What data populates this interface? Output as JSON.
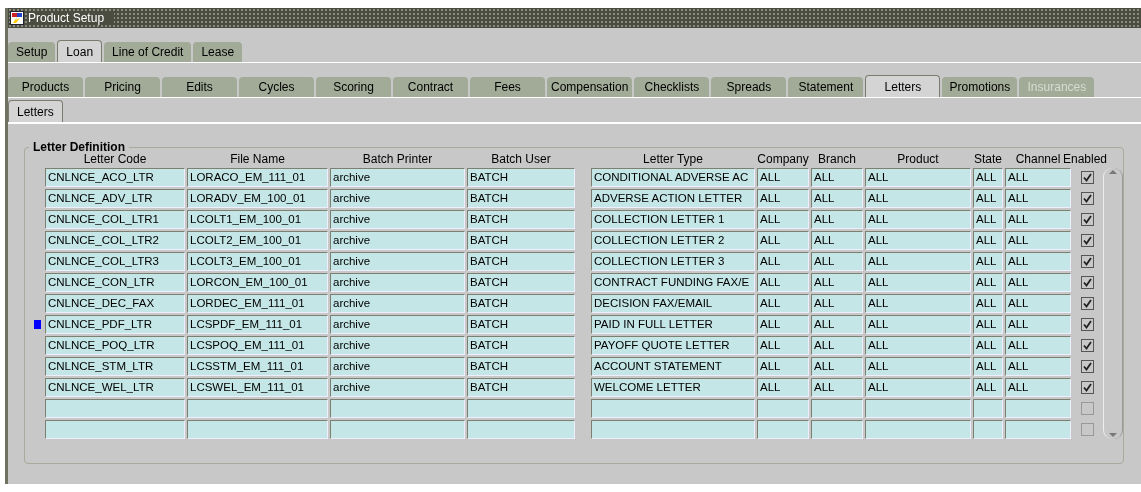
{
  "window": {
    "title": "Product Setup"
  },
  "tabs": [
    {
      "label": "Setup",
      "selected": false
    },
    {
      "label": "Loan",
      "selected": true
    },
    {
      "label": "Line of Credit",
      "selected": false
    },
    {
      "label": "Lease",
      "selected": false
    }
  ],
  "subtabs": [
    {
      "label": "Products",
      "selected": false,
      "disabled": false
    },
    {
      "label": "Pricing",
      "selected": false,
      "disabled": false
    },
    {
      "label": "Edits",
      "selected": false,
      "disabled": false
    },
    {
      "label": "Cycles",
      "selected": false,
      "disabled": false
    },
    {
      "label": "Scoring",
      "selected": false,
      "disabled": false
    },
    {
      "label": "Contract",
      "selected": false,
      "disabled": false
    },
    {
      "label": "Fees",
      "selected": false,
      "disabled": false
    },
    {
      "label": "Compensation",
      "selected": false,
      "disabled": false
    },
    {
      "label": "Checklists",
      "selected": false,
      "disabled": false
    },
    {
      "label": "Spreads",
      "selected": false,
      "disabled": false
    },
    {
      "label": "Statement",
      "selected": false,
      "disabled": false
    },
    {
      "label": "Letters",
      "selected": true,
      "disabled": false
    },
    {
      "label": "Promotions",
      "selected": false,
      "disabled": false
    },
    {
      "label": "Insurances",
      "selected": false,
      "disabled": true
    }
  ],
  "inner_tabs": [
    {
      "label": "Letters",
      "selected": true
    }
  ],
  "group": {
    "title": "Letter Definition",
    "columns": [
      "Letter Code",
      "File Name",
      "Batch Printer",
      "Batch User",
      "Letter Type",
      "Company",
      "Branch",
      "Product",
      "State",
      "Channel",
      "Enabled"
    ],
    "rows": [
      {
        "selected": false,
        "letter_code": "CNLNCE_ACO_LTR",
        "file_name": "LORACO_EM_111_01",
        "batch_printer": "archive",
        "batch_user": "BATCH",
        "letter_type": "CONDITIONAL ADVERSE AC",
        "company": "ALL",
        "branch": "ALL",
        "product": "ALL",
        "state": "ALL",
        "channel": "ALL",
        "enabled": true
      },
      {
        "selected": false,
        "letter_code": "CNLNCE_ADV_LTR",
        "file_name": "LORADV_EM_100_01",
        "batch_printer": "archive",
        "batch_user": "BATCH",
        "letter_type": "ADVERSE ACTION LETTER",
        "company": "ALL",
        "branch": "ALL",
        "product": "ALL",
        "state": "ALL",
        "channel": "ALL",
        "enabled": true
      },
      {
        "selected": false,
        "letter_code": "CNLNCE_COL_LTR1",
        "file_name": "LCOLT1_EM_100_01",
        "batch_printer": "archive",
        "batch_user": "BATCH",
        "letter_type": "COLLECTION LETTER 1",
        "company": "ALL",
        "branch": "ALL",
        "product": "ALL",
        "state": "ALL",
        "channel": "ALL",
        "enabled": true
      },
      {
        "selected": false,
        "letter_code": "CNLNCE_COL_LTR2",
        "file_name": "LCOLT2_EM_100_01",
        "batch_printer": "archive",
        "batch_user": "BATCH",
        "letter_type": "COLLECTION LETTER 2",
        "company": "ALL",
        "branch": "ALL",
        "product": "ALL",
        "state": "ALL",
        "channel": "ALL",
        "enabled": true
      },
      {
        "selected": false,
        "letter_code": "CNLNCE_COL_LTR3",
        "file_name": "LCOLT3_EM_100_01",
        "batch_printer": "archive",
        "batch_user": "BATCH",
        "letter_type": "COLLECTION LETTER 3",
        "company": "ALL",
        "branch": "ALL",
        "product": "ALL",
        "state": "ALL",
        "channel": "ALL",
        "enabled": true
      },
      {
        "selected": false,
        "letter_code": "CNLNCE_CON_LTR",
        "file_name": "LORCON_EM_100_01",
        "batch_printer": "archive",
        "batch_user": "BATCH",
        "letter_type": "CONTRACT FUNDING FAX/E",
        "company": "ALL",
        "branch": "ALL",
        "product": "ALL",
        "state": "ALL",
        "channel": "ALL",
        "enabled": true
      },
      {
        "selected": false,
        "letter_code": "CNLNCE_DEC_FAX",
        "file_name": "LORDEC_EM_111_01",
        "batch_printer": "archive",
        "batch_user": "BATCH",
        "letter_type": "DECISION FAX/EMAIL",
        "company": "ALL",
        "branch": "ALL",
        "product": "ALL",
        "state": "ALL",
        "channel": "ALL",
        "enabled": true
      },
      {
        "selected": true,
        "letter_code": "CNLNCE_PDF_LTR",
        "file_name": "LCSPDF_EM_111_01",
        "batch_printer": "archive",
        "batch_user": "BATCH",
        "letter_type": "PAID IN FULL LETTER",
        "company": "ALL",
        "branch": "ALL",
        "product": "ALL",
        "state": "ALL",
        "channel": "ALL",
        "enabled": true
      },
      {
        "selected": false,
        "letter_code": "CNLNCE_POQ_LTR",
        "file_name": "LCSPOQ_EM_111_01",
        "batch_printer": "archive",
        "batch_user": "BATCH",
        "letter_type": "PAYOFF QUOTE LETTER",
        "company": "ALL",
        "branch": "ALL",
        "product": "ALL",
        "state": "ALL",
        "channel": "ALL",
        "enabled": true
      },
      {
        "selected": false,
        "letter_code": "CNLNCE_STM_LTR",
        "file_name": "LCSSTM_EM_111_01",
        "batch_printer": "archive",
        "batch_user": "BATCH",
        "letter_type": "ACCOUNT STATEMENT",
        "company": "ALL",
        "branch": "ALL",
        "product": "ALL",
        "state": "ALL",
        "channel": "ALL",
        "enabled": true
      },
      {
        "selected": false,
        "letter_code": "CNLNCE_WEL_LTR",
        "file_name": "LCSWEL_EM_111_01",
        "batch_printer": "archive",
        "batch_user": "BATCH",
        "letter_type": "WELCOME LETTER",
        "company": "ALL",
        "branch": "ALL",
        "product": "ALL",
        "state": "ALL",
        "channel": "ALL",
        "enabled": true
      },
      {
        "selected": false,
        "enabled": false
      },
      {
        "selected": false,
        "enabled": false
      }
    ]
  }
}
